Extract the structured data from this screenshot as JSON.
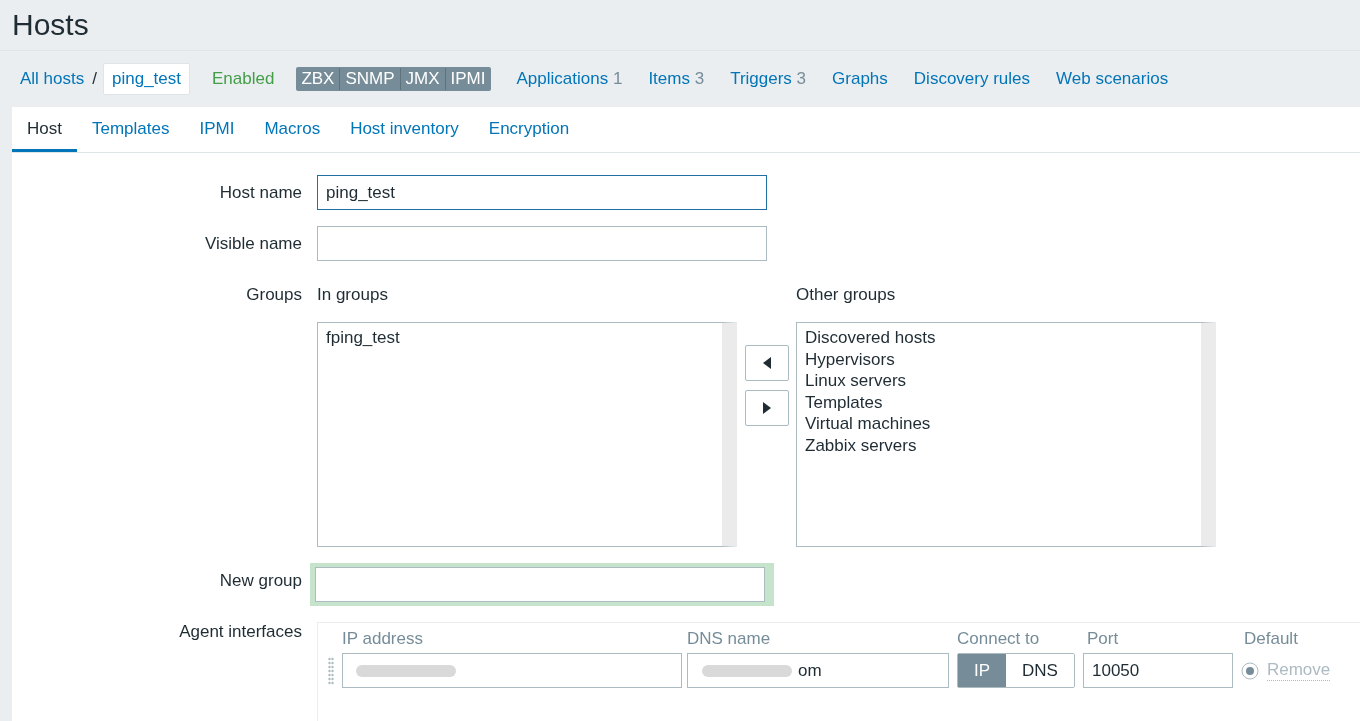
{
  "page_title": "Hosts",
  "breadcrumb": {
    "all_hosts": "All hosts",
    "separator": "/",
    "current": "ping_test"
  },
  "status": "Enabled",
  "availability": [
    "ZBX",
    "SNMP",
    "JMX",
    "IPMI"
  ],
  "nav_links": [
    {
      "label": "Applications",
      "count": "1"
    },
    {
      "label": "Items",
      "count": "3"
    },
    {
      "label": "Triggers",
      "count": "3"
    },
    {
      "label": "Graphs"
    },
    {
      "label": "Discovery rules"
    },
    {
      "label": "Web scenarios"
    }
  ],
  "tabs": [
    {
      "label": "Host",
      "selected": true
    },
    {
      "label": "Templates",
      "selected": false
    },
    {
      "label": "IPMI",
      "selected": false
    },
    {
      "label": "Macros",
      "selected": false
    },
    {
      "label": "Host inventory",
      "selected": false
    },
    {
      "label": "Encryption",
      "selected": false
    }
  ],
  "form": {
    "host_name": {
      "label": "Host name",
      "value": "ping_test"
    },
    "visible_name": {
      "label": "Visible name"
    },
    "groups": {
      "label": "Groups",
      "in_label": "In groups",
      "in_groups": [
        "fping_test"
      ],
      "other_label": "Other groups",
      "other_groups": [
        "Discovered hosts",
        "Hypervisors",
        "Linux servers",
        "Templates",
        "Virtual machines",
        "Zabbix servers"
      ]
    },
    "new_group": {
      "label": "New group"
    },
    "agent_interfaces": {
      "label": "Agent interfaces",
      "columns": [
        "IP address",
        "DNS name",
        "Connect to",
        "Port",
        "Default"
      ],
      "rows": [
        {
          "dns_value": "om",
          "connect": [
            {
              "label": "IP",
              "selected": true
            },
            {
              "label": "DNS",
              "selected": false
            }
          ],
          "port": "10050",
          "default": true,
          "remove": "Remove"
        }
      ]
    }
  }
}
